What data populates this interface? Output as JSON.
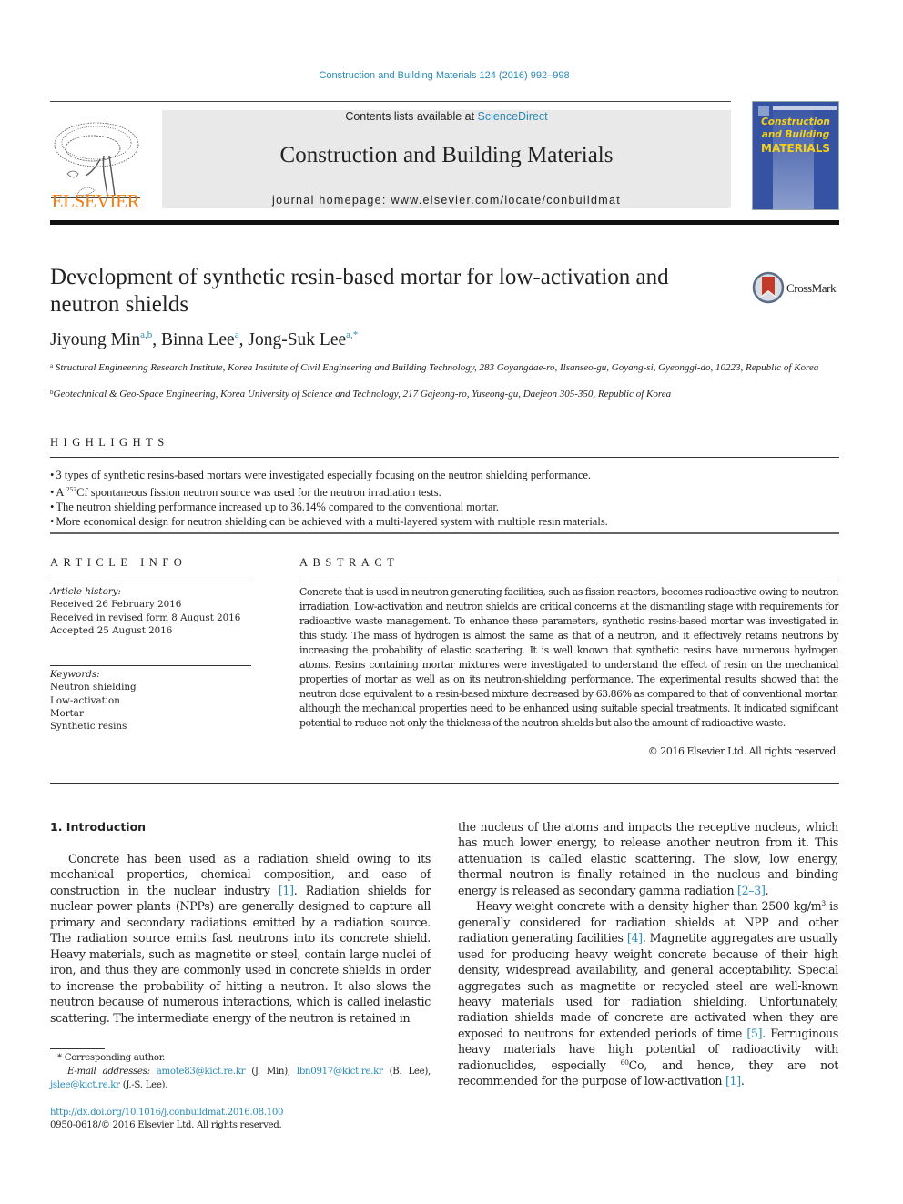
{
  "header": {
    "citation": "Construction and Building Materials 124 (2016) 992–998",
    "contents_prefix": "Contents lists available at ",
    "contents_link": "ScienceDirect",
    "journal_title": "Construction and Building Materials",
    "homepage_prefix": "journal homepage: ",
    "homepage_url": "www.elsevier.com/locate/conbuildmat",
    "publisher_logo_text": "ELSEVIER",
    "cover": {
      "line1": "Construction",
      "line2": "and Building",
      "line3": "MATERIALS"
    },
    "colors": {
      "link": "#2a8ab5",
      "elsevier_orange": "#f07f13",
      "cover_blue": "#3552a3",
      "cover_yellow": "#f5d11a"
    }
  },
  "article": {
    "title": "Development of synthetic resin-based mortar for low-activation and neutron shields",
    "crossmark_label": "CrossMark",
    "authors": [
      {
        "name": "Jiyoung Min",
        "sup": "a,b"
      },
      {
        "name": "Binna Lee",
        "sup": "a"
      },
      {
        "name": "Jong-Suk Lee",
        "sup": "a,*"
      }
    ],
    "affiliations": [
      {
        "sup": "a",
        "text": "Structural Engineering Research Institute, Korea Institute of Civil Engineering and Building Technology, 283 Goyangdae-ro, Ilsanseo-gu, Goyang-si, Gyeonggi-do, 10223, Republic of Korea"
      },
      {
        "sup": "b",
        "text": "Geotechnical & Geo-Space Engineering, Korea University of Science and Technology, 217 Gajeong-ro, Yuseong-gu, Daejeon 305-350, Republic of Korea"
      }
    ]
  },
  "highlights": {
    "heading": "HIGHLIGHTS",
    "items": [
      {
        "pre": "3 types of synthetic resins-based mortars were investigated especially focusing on the neutron shielding performance.",
        "sup": "",
        "post": ""
      },
      {
        "pre": "A ",
        "sup": "252",
        "post": "Cf spontaneous fission neutron source was used for the neutron irradiation tests."
      },
      {
        "pre": "The neutron shielding performance increased up to 36.14% compared to the conventional mortar.",
        "sup": "",
        "post": ""
      },
      {
        "pre": "More economical design for neutron shielding can be achieved with a multi-layered system with multiple resin materials.",
        "sup": "",
        "post": ""
      }
    ]
  },
  "article_info": {
    "heading": "ARTICLE INFO",
    "history_label": "Article history:",
    "history": [
      "Received 26 February 2016",
      "Received in revised form 8 August 2016",
      "Accepted 25 August 2016"
    ],
    "keywords_label": "Keywords:",
    "keywords": [
      "Neutron shielding",
      "Low-activation",
      "Mortar",
      "Synthetic resins"
    ]
  },
  "abstract": {
    "heading": "ABSTRACT",
    "text": "Concrete that is used in neutron generating facilities, such as fission reactors, becomes radioactive owing to neutron irradiation. Low-activation and neutron shields are critical concerns at the dismantling stage with requirements for radioactive waste management. To enhance these parameters, synthetic resins-based mortar was investigated in this study. The mass of hydrogen is almost the same as that of a neutron, and it effectively retains neutrons by increasing the probability of elastic scattering. It is well known that synthetic resins have numerous hydrogen atoms. Resins containing mortar mixtures were investigated to understand the effect of resin on the mechanical properties of mortar as well as on its neutron-shielding performance. The experimental results showed that the neutron dose equivalent to a resin-based mixture decreased by 63.86% as compared to that of conventional mortar, although the mechanical properties need to be enhanced using suitable special treatments. It indicated significant potential to reduce not only the thickness of the neutron shields but also the amount of radioactive waste.",
    "copyright": "© 2016 Elsevier Ltd. All rights reserved."
  },
  "body": {
    "intro_heading": "1. Introduction",
    "left_p1": [
      {
        "t": "Concrete has been used as a radiation shield owing to its mechanical properties, chemical composition, and ease of construction in the nuclear industry "
      },
      {
        "ref": "[1]"
      },
      {
        "t": ". Radiation shields for nuclear power plants (NPPs) are generally designed to capture all primary and secondary radiations emitted by a radiation source. The radiation source emits fast neutrons into its concrete shield. Heavy materials, such as magnetite or steel, contain large nuclei of iron, and thus they are commonly used in concrete shields in order to increase the probability of hitting a neutron. It also slows the neutron because of numerous interactions, which is called inelastic scattering. The intermediate energy of the neutron is retained in"
      }
    ],
    "right_p1": [
      {
        "t": "the nucleus of the atoms and impacts the receptive nucleus, which has much lower energy, to release another neutron from it. This attenuation is called elastic scattering. The slow, low energy, thermal neutron is finally retained in the nucleus and binding energy is released as secondary gamma radiation "
      },
      {
        "ref": "[2–3]"
      },
      {
        "t": "."
      }
    ],
    "right_p2": [
      {
        "t": "Heavy weight concrete with a density higher than 2500 kg/m"
      },
      {
        "sup": "3"
      },
      {
        "t": " is generally considered for radiation shields at NPP and other radiation generating facilities "
      },
      {
        "ref": "[4]"
      },
      {
        "t": ". Magnetite aggregates are usually used for producing heavy weight concrete because of their high density, widespread availability, and general acceptability. Special aggregates such as magnetite or recycled steel are well-known heavy materials used for radiation shielding. Unfortunately, radiation shields made of concrete are activated when they are exposed to neutrons for extended periods of time "
      },
      {
        "ref": "[5]"
      },
      {
        "t": ". Ferruginous heavy materials have high potential of radioactivity with radionuclides, especially "
      },
      {
        "sup": "60"
      },
      {
        "t": "Co, and hence, they are not recommended for the purpose of low-activation "
      },
      {
        "ref": "[1]"
      },
      {
        "t": "."
      }
    ]
  },
  "footnotes": {
    "corresponding": "* Corresponding author.",
    "email_label": "E-mail addresses: ",
    "emails": [
      {
        "addr": "amote83@kict.re.kr",
        "who": " (J. Min), "
      },
      {
        "addr": "lbn0917@kict.re.kr",
        "who": " (B. Lee), "
      },
      {
        "addr": "jslee@kict.re.kr",
        "who": " (J.-S. Lee)."
      }
    ],
    "doi": "http://dx.doi.org/10.1016/j.conbuildmat.2016.08.100",
    "issn": "0950-0618/© 2016 Elsevier Ltd. All rights reserved."
  }
}
